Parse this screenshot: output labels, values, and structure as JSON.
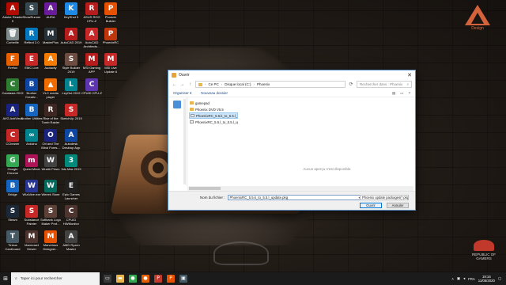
{
  "desktop": {
    "icons": [
      {
        "label": "Adobe Reader 9",
        "glyph": "A",
        "color": "#b30b00"
      },
      {
        "label": "Corbeille",
        "glyph": "🗑",
        "color": "#7f8c8d"
      },
      {
        "label": "Firefox",
        "glyph": "F",
        "color": "#e66000"
      },
      {
        "label": "Camtasia 2019",
        "glyph": "C",
        "color": "#2e7d32"
      },
      {
        "label": "AVG AntiVirus",
        "glyph": "A",
        "color": "#1a237e"
      },
      {
        "label": "CCleaner",
        "glyph": "C",
        "color": "#c62828"
      },
      {
        "label": "Google Chrome",
        "glyph": "G",
        "color": "#34a853"
      },
      {
        "label": "Bridge",
        "glyph": "B",
        "color": "#1565c0"
      },
      {
        "label": "Steam",
        "glyph": "S",
        "color": "#1b2838"
      },
      {
        "label": "Tinkus Cardboard",
        "glyph": "T",
        "color": "#455a64"
      },
      {
        "label": "ShowRunner",
        "glyph": "S",
        "color": "#37474f"
      },
      {
        "label": "Reflect 2.0",
        "glyph": "R",
        "color": "#0277bd"
      },
      {
        "label": "EMC Live",
        "glyph": "E",
        "color": "#c62828"
      },
      {
        "label": "Brother Creativ...",
        "glyph": "B",
        "color": "#0d47a1"
      },
      {
        "label": "Brother Utilities",
        "glyph": "B",
        "color": "#1565c0"
      },
      {
        "label": "Arduino",
        "glyph": "∞",
        "color": "#00838f"
      },
      {
        "label": "Quest Miner",
        "glyph": "m",
        "color": "#ad1457"
      },
      {
        "label": "WizAlive.exe",
        "glyph": "W",
        "color": "#283593"
      },
      {
        "label": "Substance Painter",
        "glyph": "S",
        "color": "#c62828"
      },
      {
        "label": "Marmoset Viewer",
        "glyph": "M",
        "color": "#4e342e"
      },
      {
        "label": "AURA",
        "glyph": "A",
        "color": "#6a1b9a"
      },
      {
        "label": "MasterPlus",
        "glyph": "M",
        "color": "#263238"
      },
      {
        "label": "Audacity",
        "glyph": "A",
        "color": "#f57c00"
      },
      {
        "label": "VLC media player",
        "glyph": "▲",
        "color": "#ef6c00"
      },
      {
        "label": "Rise of the Tomb Raider",
        "glyph": "R",
        "color": "#3e2723"
      },
      {
        "label": "Ori and The Blind Fores...",
        "glyph": "O",
        "color": "#1a237e"
      },
      {
        "label": "Wraith Prism",
        "glyph": "W",
        "color": "#424242"
      },
      {
        "label": "Weeek Store",
        "glyph": "W",
        "color": "#00695c"
      },
      {
        "label": "Softbank Logo Maker Prof...",
        "glyph": "S",
        "color": "#5d4037"
      },
      {
        "label": "Marvelous Designer...",
        "glyph": "M",
        "color": "#e65100"
      },
      {
        "label": "KeyShot 9",
        "glyph": "K",
        "color": "#1e88e5"
      },
      {
        "label": "AutoCAD 2019",
        "glyph": "A",
        "color": "#b71c1c"
      },
      {
        "label": "Style Builder 2019",
        "glyph": "S",
        "color": "#6d4c41"
      },
      {
        "label": "LeyOut 2019",
        "glyph": "L",
        "color": "#00838f"
      },
      {
        "label": "SketchUp 2019",
        "glyph": "S",
        "color": "#c62828"
      },
      {
        "label": "Autodesk Desktop App",
        "glyph": "A",
        "color": "#0d47a1"
      },
      {
        "label": "3ds Max 2019",
        "glyph": "3",
        "color": "#00897b"
      },
      {
        "label": "Epic Games Launcher",
        "glyph": "E",
        "color": "#212121"
      },
      {
        "label": "CPUID HWMonitor",
        "glyph": "C",
        "color": "#4e342e"
      },
      {
        "label": "AMD Ryzen Master",
        "glyph": "A",
        "color": "#424242"
      },
      {
        "label": "ASUS ROG CPU-Z",
        "glyph": "R",
        "color": "#b71c1c"
      },
      {
        "label": "AutoCAD Architectu...",
        "glyph": "A",
        "color": "#c62828"
      },
      {
        "label": "MSI Gaming APP",
        "glyph": "M",
        "color": "#b71c1c"
      },
      {
        "label": "CPUID CPU-Z",
        "glyph": "C",
        "color": "#5e35b1"
      },
      {
        "label": "Phoenix Builder",
        "glyph": "P",
        "color": "#e65100"
      },
      {
        "label": "PhoenixRC",
        "glyph": "P",
        "color": "#bf360c"
      },
      {
        "label": "MSI Live Update 6",
        "glyph": "M",
        "color": "#c62828"
      }
    ]
  },
  "dialog": {
    "title": "Ouvrir",
    "close_glyph": "✕",
    "nav": {
      "back": "←",
      "forward": "→",
      "up": "↑"
    },
    "address": {
      "crumbs": [
        "Ce PC",
        "Disque local (C:)",
        "Phoenix"
      ],
      "separator": "›"
    },
    "search_placeholder": "Rechercher dans : Phoenix",
    "toolbar": {
      "organize": "Organiser ▾",
      "new_folder": "Nouveau dossier"
    },
    "files": [
      {
        "name": "gamepad",
        "type": "folder",
        "selected": false
      },
      {
        "name": "Phoenix DVD V5.5",
        "type": "folder",
        "selected": false
      },
      {
        "name": "PhoenixRC_5.5.k_to_5.5.l_update",
        "type": "pkg",
        "selected": true
      },
      {
        "name": "PhoenixRC_5.5.l_to_5.5.l_update",
        "type": "pkg",
        "selected": false
      }
    ],
    "preview_message": "Aucun aperçu n'est disponible.",
    "filename_label": "Nom du fichier :",
    "filename_value": "PhoenixRC_5.5.k_to_5.5.l_update.pkg",
    "filter_value": "Phoenix update packages(*.pkg",
    "open_button": "Ouvrir",
    "cancel_button": "Annuler"
  },
  "branding": {
    "design_text": "Design",
    "rog_text": "REPUBLIC OF GAMERS"
  },
  "taskbar": {
    "search_placeholder": "Taper ici pour rechercher",
    "tray_lang": "FRA",
    "time": "19:16",
    "date": "11/05/2020"
  }
}
